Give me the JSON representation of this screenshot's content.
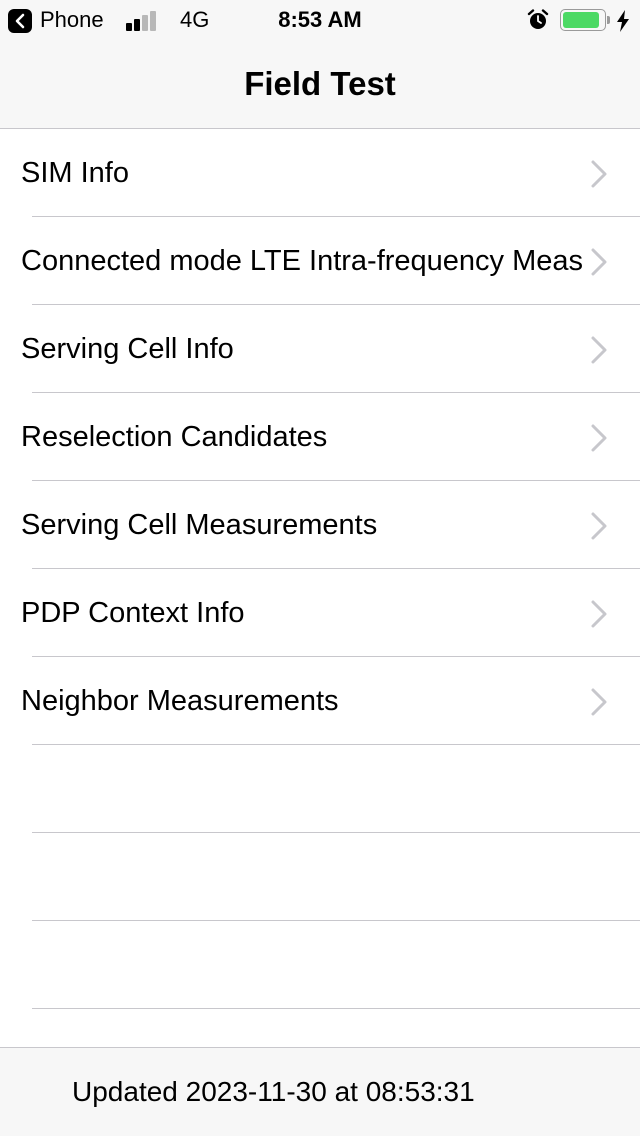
{
  "status_bar": {
    "back_app": "Phone",
    "network": "4G",
    "time": "8:53 AM",
    "signal_bars_filled": 2,
    "signal_bars_total": 4,
    "battery_level": 0.9,
    "battery_color": "#4cd964",
    "icons": [
      "back-icon",
      "signal-icon",
      "alarm-icon",
      "battery-icon",
      "charging-icon"
    ]
  },
  "nav": {
    "title": "Field Test"
  },
  "list": {
    "items": [
      {
        "label": "SIM Info"
      },
      {
        "label": "Connected mode LTE Intra-frequency Meas"
      },
      {
        "label": "Serving Cell Info"
      },
      {
        "label": "Reselection Candidates"
      },
      {
        "label": "Serving Cell Measurements"
      },
      {
        "label": "PDP Context Info"
      },
      {
        "label": "Neighbor Measurements"
      }
    ],
    "empty_rows": 3,
    "chevron_icon": "chevron-right-icon"
  },
  "footer": {
    "updated_text": "Updated 2023-11-30 at 08:53:31"
  },
  "colors": {
    "bar_background": "#f7f7f7",
    "separator": "#c8c7cc",
    "chevron": "#c7c7cc"
  }
}
